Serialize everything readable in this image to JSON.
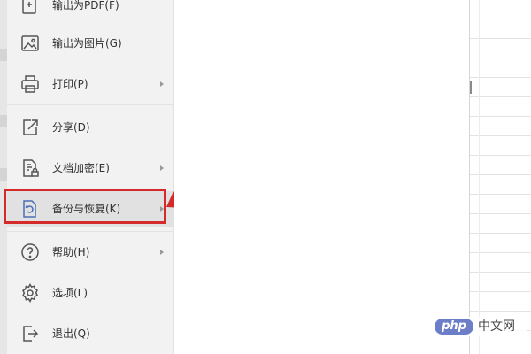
{
  "menu": {
    "items": [
      {
        "label": "输出为PDF(F)",
        "icon": "export-pdf-icon",
        "has_submenu": false
      },
      {
        "label": "输出为图片(G)",
        "icon": "export-image-icon",
        "has_submenu": false
      },
      {
        "label": "打印(P)",
        "icon": "printer-icon",
        "has_submenu": true
      },
      {
        "label": "分享(D)",
        "icon": "share-icon",
        "has_submenu": false
      },
      {
        "label": "文档加密(E)",
        "icon": "document-lock-icon",
        "has_submenu": true
      },
      {
        "label": "备份与恢复(K)",
        "icon": "backup-restore-icon",
        "has_submenu": true,
        "highlighted": true
      },
      {
        "label": "帮助(H)",
        "icon": "help-icon",
        "has_submenu": true
      },
      {
        "label": "选项(L)",
        "icon": "gear-icon",
        "has_submenu": false
      },
      {
        "label": "退出(Q)",
        "icon": "exit-icon",
        "has_submenu": false
      }
    ]
  },
  "annotation": {
    "box_color": "#d42a2a",
    "arrow_color": "#d42a2a"
  },
  "watermark": {
    "badge": "php",
    "text": "中文网"
  },
  "colors": {
    "menu_bg": "#f2f2f2",
    "highlight_bg": "#e1e1e1",
    "text": "#333333"
  }
}
